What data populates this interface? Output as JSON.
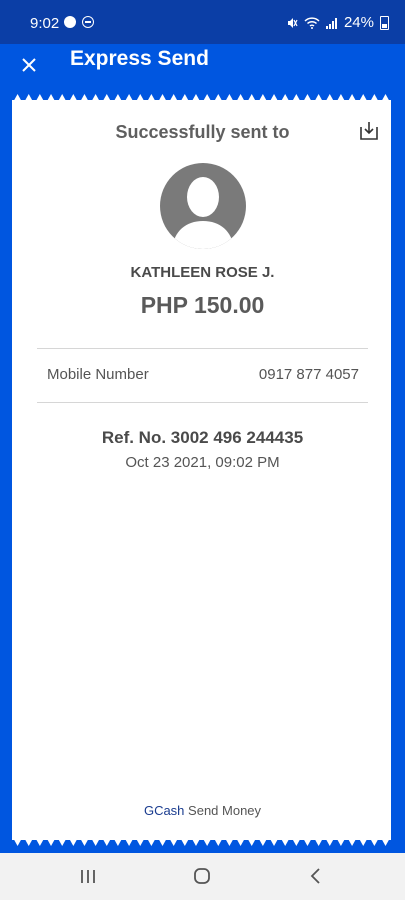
{
  "status_bar": {
    "time": "9:02",
    "battery": "24%"
  },
  "header": {
    "title": "Express Send"
  },
  "receipt": {
    "heading": "Successfully sent to",
    "recipient_name": "KATHLEEN ROSE J.",
    "amount": "PHP 150.00",
    "details": [
      {
        "label": "Mobile Number",
        "value": "0917 877 4057"
      }
    ],
    "reference": "Ref. No. 3002 496 244435",
    "timestamp": "Oct 23 2021, 09:02 PM",
    "footer": {
      "brand": "GCash",
      "service": "Send Money"
    }
  },
  "colors": {
    "primary": "#0056e0",
    "status_bar": "#0b3ea6",
    "brand_text": "#1a3c8f"
  },
  "icons": [
    "close-icon",
    "download-icon",
    "avatar-placeholder-icon",
    "recent-apps-icon",
    "home-icon",
    "back-icon"
  ]
}
